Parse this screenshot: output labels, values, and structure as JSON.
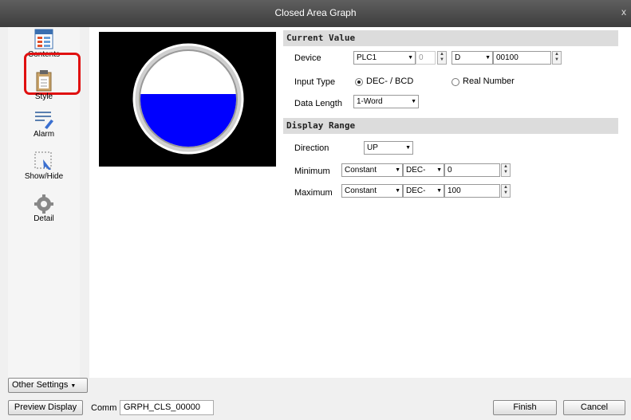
{
  "window": {
    "title": "Closed Area Graph",
    "close_glyph": "x"
  },
  "sidebar": {
    "items": [
      {
        "label": "Contents",
        "icon": "contents-icon"
      },
      {
        "label": "Style",
        "icon": "style-icon"
      },
      {
        "label": "Alarm",
        "icon": "alarm-icon"
      },
      {
        "label": "Show/Hide",
        "icon": "show-hide-icon"
      },
      {
        "label": "Detail",
        "icon": "detail-icon"
      }
    ],
    "selected": "Contents",
    "other_settings": "Other Settings"
  },
  "preview": {
    "fill_level": 0.55,
    "fill_color": "#0000ff"
  },
  "current_value": {
    "heading": "Current Value",
    "device_label": "Device",
    "device_plc": "PLC1",
    "device_station": "0",
    "device_type": "D",
    "device_address": "00100",
    "input_type_label": "Input Type",
    "input_type_options": [
      "DEC- / BCD",
      "Real Number"
    ],
    "input_type_selected": "DEC- / BCD",
    "data_length_label": "Data Length",
    "data_length": "1-Word"
  },
  "display_range": {
    "heading": "Display Range",
    "direction_label": "Direction",
    "direction": "UP",
    "minimum_label": "Minimum",
    "minimum_source": "Constant",
    "minimum_format": "DEC-",
    "minimum_value": "0",
    "maximum_label": "Maximum",
    "maximum_source": "Constant",
    "maximum_format": "DEC-",
    "maximum_value": "100"
  },
  "footer": {
    "preview_display": "Preview Display",
    "comm_label": "Comm",
    "comm_value": "GRPH_CLS_00000",
    "finish": "Finish",
    "cancel": "Cancel"
  }
}
